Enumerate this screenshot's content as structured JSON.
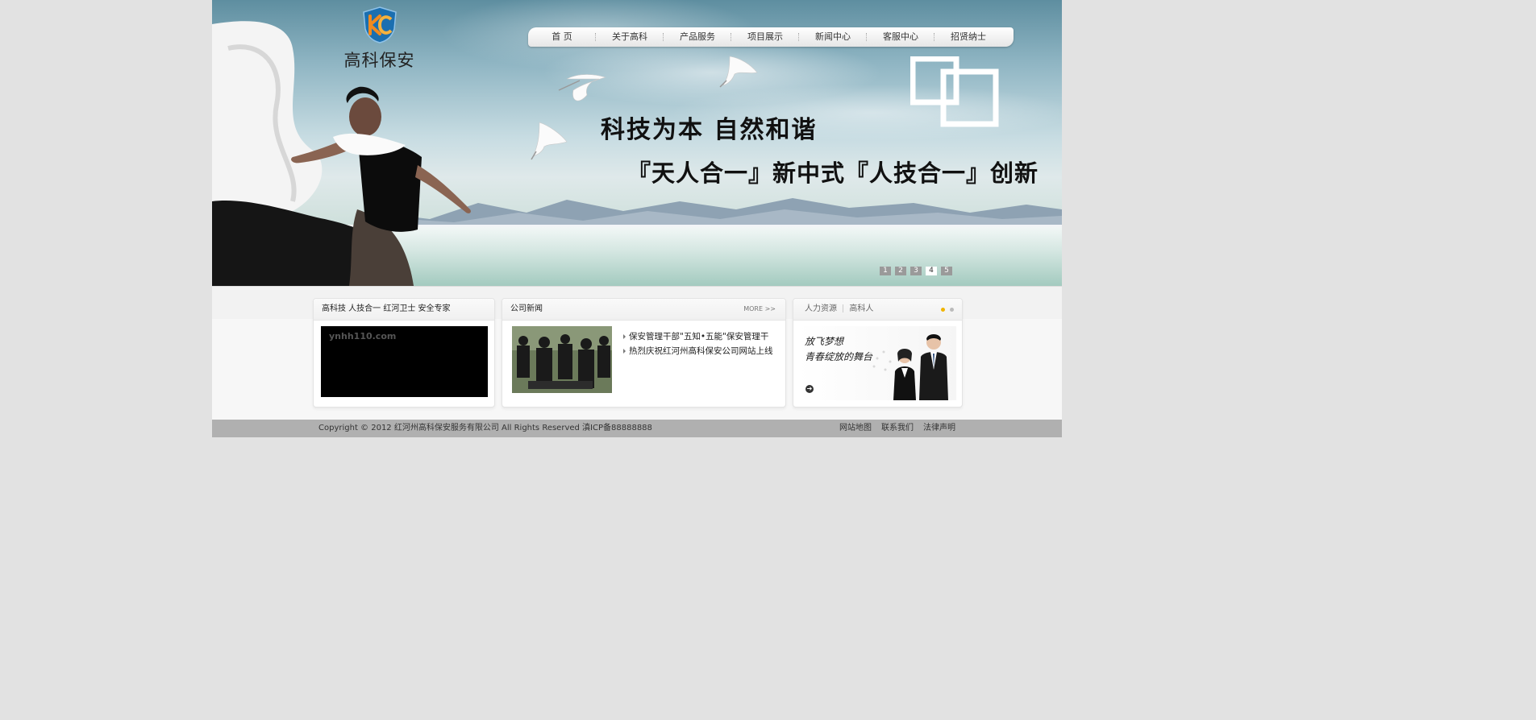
{
  "logo": {
    "text": "高科保安",
    "icon": "kc-shield-logo"
  },
  "nav": {
    "items": [
      "首 页",
      "关于高科",
      "产品服务",
      "项目展示",
      "新闻中心",
      "客服中心",
      "招贤纳士"
    ]
  },
  "banner": {
    "slogan1": "科技为本 自然和谐",
    "slogan2": "『天人合一』新中式『人技合一』创新",
    "pager": [
      "1",
      "2",
      "3",
      "4",
      "5"
    ],
    "active_slide": "4"
  },
  "panel_video": {
    "title": "高科技 人技合一 红河卫士 安全专家",
    "watermark": "ynhh110.com"
  },
  "panel_news": {
    "title": "公司新闻",
    "more": "MORE >>",
    "items": [
      "保安管理干部\"五知•五能\"保安管理干",
      "热烈庆祝红河州高科保安公司网站上线"
    ]
  },
  "panel_hr": {
    "tabs": [
      "人力资源",
      "高科人"
    ],
    "line1": "放飞梦想",
    "line2": "青春绽放的舞台"
  },
  "footer": {
    "copyright": "Copyright © 2012 红河州高科保安服务有限公司 All Rights Reserved 滇ICP备88888888",
    "links": [
      "网站地图",
      "联系我们",
      "法律声明"
    ]
  },
  "colors": {
    "accent_dot": "#f0b400",
    "footer_bg": "#b0b0b0",
    "page_bg": "#e2e2e2"
  }
}
